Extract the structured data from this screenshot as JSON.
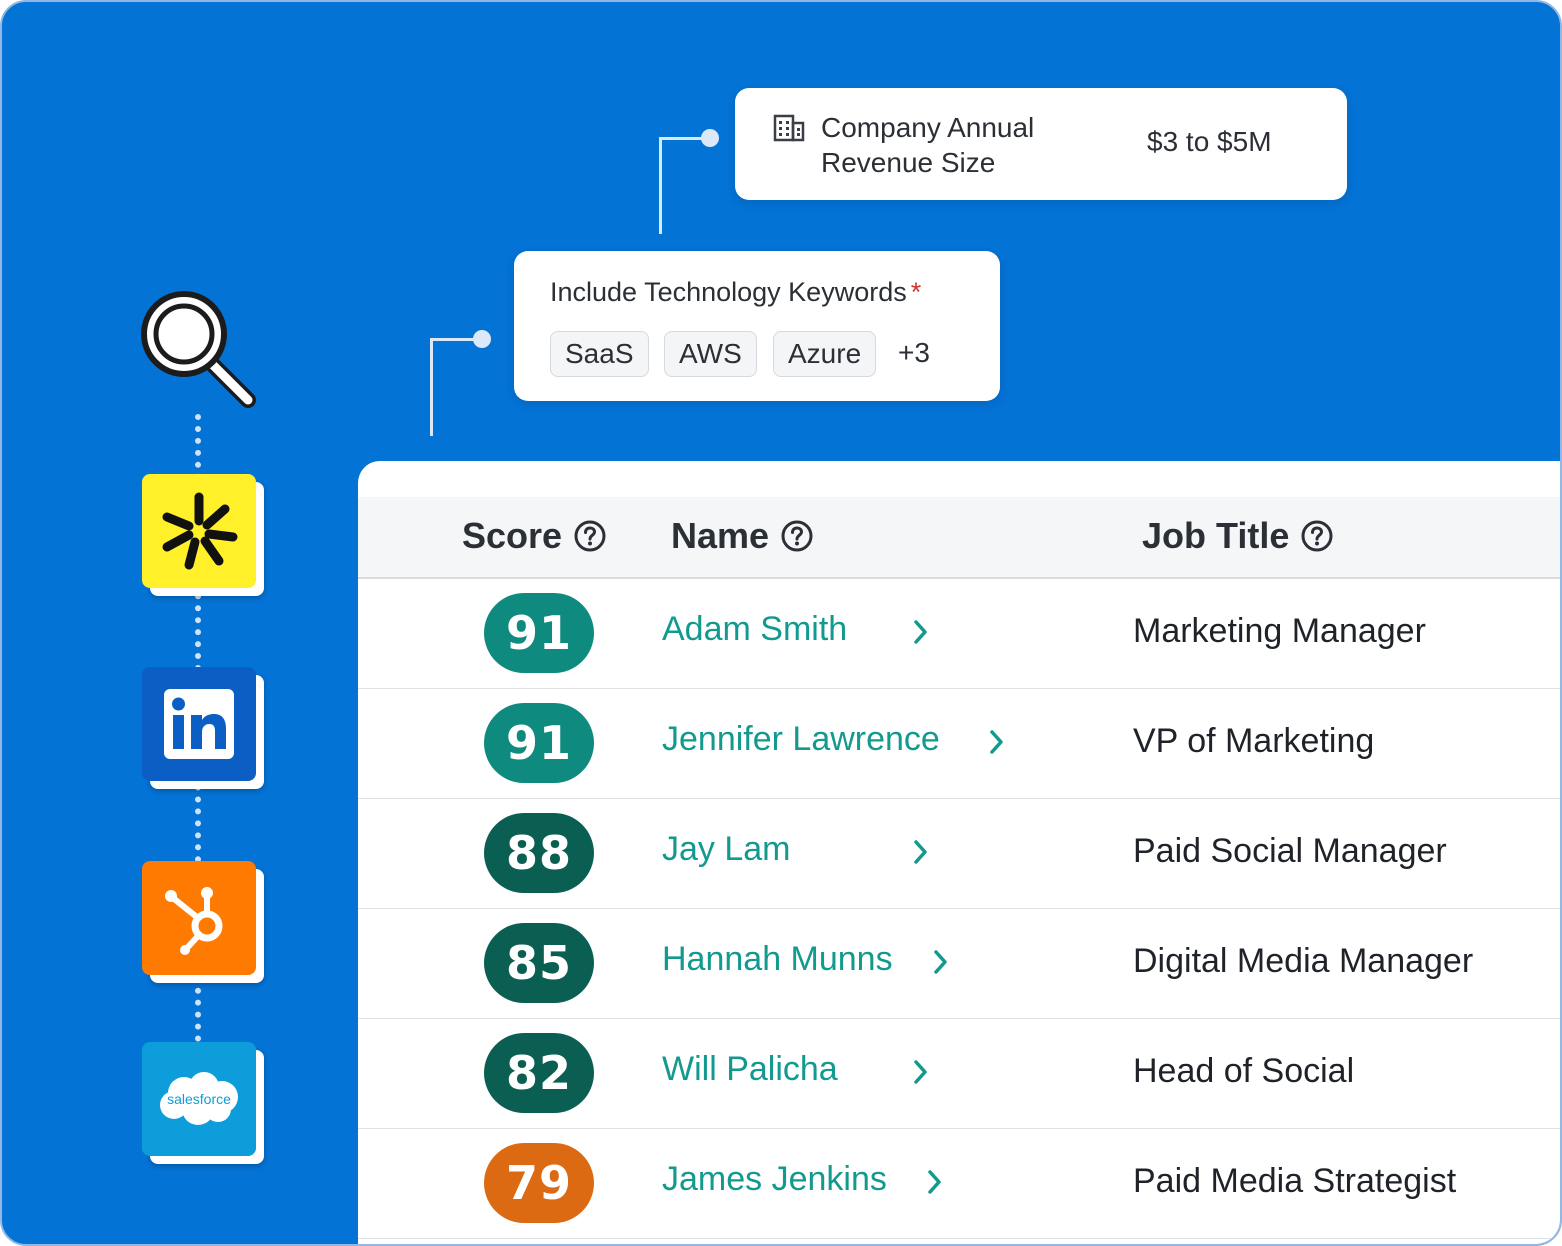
{
  "filters": {
    "revenue": {
      "icon": "building-icon",
      "label": "Company Annual Revenue Size",
      "value": "$3 to $5M"
    },
    "keywords": {
      "label": "Include Technology Keywords",
      "required_mark": "*",
      "chips": [
        "SaaS",
        "AWS",
        "Azure"
      ],
      "more": "+3"
    }
  },
  "integrations": [
    {
      "icon": "search-icon"
    },
    {
      "icon": "starburst-logo-icon",
      "color": "#fff02a"
    },
    {
      "icon": "linkedin-logo-icon",
      "color": "#0a66c2"
    },
    {
      "icon": "hubspot-logo-icon",
      "color": "#ff7a00"
    },
    {
      "icon": "salesforce-logo-icon",
      "color": "#0d9dda",
      "text": "salesforce"
    }
  ],
  "table": {
    "columns": [
      "Score",
      "Name",
      "Job Title"
    ],
    "rows": [
      {
        "score": "91",
        "name": "Adam Smith",
        "title": "Marketing Manager",
        "color": "#0f8a7e"
      },
      {
        "score": "91",
        "name": "Jennifer Lawrence",
        "title": "VP of Marketing",
        "color": "#0f8a7e"
      },
      {
        "score": "88",
        "name": "Jay Lam",
        "title": "Paid Social Manager",
        "color": "#0b5e52"
      },
      {
        "score": "85",
        "name": "Hannah Munns",
        "title": "Digital Media Manager",
        "color": "#0b5e52"
      },
      {
        "score": "82",
        "name": "Will Palicha",
        "title": "Head of Social",
        "color": "#0b5e52"
      },
      {
        "score": "79",
        "name": "James Jenkins",
        "title": "Paid Media Strategist",
        "color": "#db6a13"
      }
    ]
  },
  "colors": {
    "background": "#0473d6",
    "name_link": "#139a8e"
  }
}
